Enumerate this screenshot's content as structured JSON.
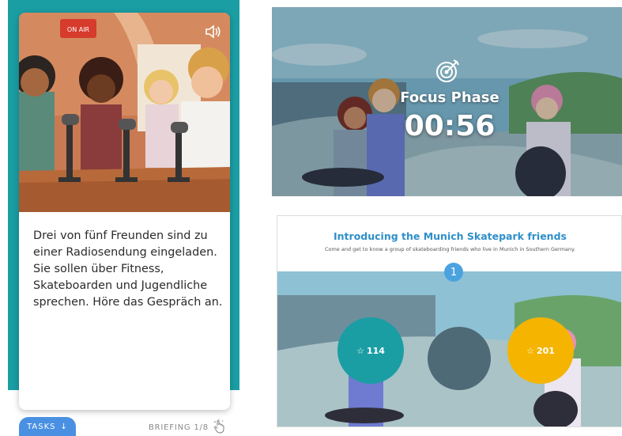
{
  "briefing": {
    "on_air_sign": "ON AIR",
    "text": "Drei von fünf Freunden sind zu einer Radiosendung eingeladen. Sie sollen über Fitness, Skateboarden und Jugendliche sprechen. Höre das Gespräch an.",
    "tasks_label": "TASKS",
    "counter": "BRIEFING 1/8"
  },
  "focus": {
    "label": "Focus Phase",
    "timer": "00:56"
  },
  "intro": {
    "title": "Introducing the Munich Skatepark friends",
    "subtitle": "Come and get to know a group of skateboarding friends who live in Munich in Southern Germany.",
    "step": "1",
    "bubbles": [
      {
        "icon": "☆",
        "value": "114"
      },
      {
        "icon": "☆",
        "value": "201"
      }
    ]
  },
  "colors": {
    "teal": "#1a9ea4",
    "blue": "#4a90e2",
    "yellow": "#f5b400",
    "title_blue": "#2f8fc9"
  }
}
